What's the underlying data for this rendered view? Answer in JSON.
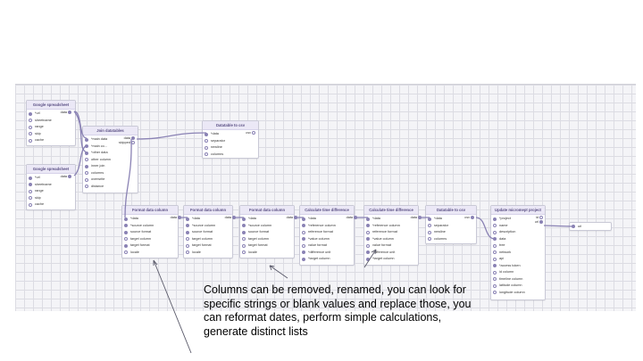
{
  "nodes": {
    "gs1": {
      "title": "Google spreadsheet",
      "output": "data",
      "rows": [
        {
          "label": "*url",
          "on": true
        },
        {
          "label": "sheetname",
          "on": false
        },
        {
          "label": "range",
          "on": false
        },
        {
          "label": "skip",
          "on": false
        },
        {
          "label": "cache",
          "on": false
        }
      ]
    },
    "gs2": {
      "title": "Google spreadsheet",
      "output": "data",
      "rows": [
        {
          "label": "*url",
          "on": true
        },
        {
          "label": "sheetname",
          "on": true
        },
        {
          "label": "range",
          "on": false
        },
        {
          "label": "skip",
          "on": false
        },
        {
          "label": "cache",
          "on": false
        }
      ]
    },
    "join": {
      "title": "Join datatables",
      "output": "data",
      "output2": "skipped",
      "rows": [
        {
          "label": "*main data",
          "on": true
        },
        {
          "label": "*main co...",
          "on": true
        },
        {
          "label": "*other data",
          "on": true
        },
        {
          "label": "other column",
          "on": false
        },
        {
          "label": "inner join",
          "on": true
        },
        {
          "label": "columns",
          "on": false
        },
        {
          "label": "overwrite",
          "on": false
        },
        {
          "label": "distance",
          "on": false
        }
      ]
    },
    "csv1": {
      "title": "Datatable to csv",
      "output": "csv",
      "rows": [
        {
          "label": "*data",
          "on": true
        },
        {
          "label": "separator",
          "on": false
        },
        {
          "label": "newline",
          "on": false
        },
        {
          "label": "columns",
          "on": false
        }
      ]
    },
    "fmt1": {
      "title": "Format data column",
      "output": "data",
      "rows": [
        {
          "label": "*data",
          "on": true
        },
        {
          "label": "*source column",
          "on": true
        },
        {
          "label": "source format",
          "on": true
        },
        {
          "label": "target column",
          "on": false
        },
        {
          "label": "target format",
          "on": true
        },
        {
          "label": "locale",
          "on": false
        }
      ]
    },
    "fmt2": {
      "title": "Format data column",
      "output": "data",
      "rows": [
        {
          "label": "*data",
          "on": true
        },
        {
          "label": "*source column",
          "on": true
        },
        {
          "label": "source format",
          "on": true
        },
        {
          "label": "target column",
          "on": false
        },
        {
          "label": "target format",
          "on": false
        },
        {
          "label": "locale",
          "on": false
        }
      ]
    },
    "fmt3": {
      "title": "Format data column",
      "output": "data",
      "rows": [
        {
          "label": "*data",
          "on": true
        },
        {
          "label": "*source column",
          "on": true
        },
        {
          "label": "source format",
          "on": true
        },
        {
          "label": "target column",
          "on": false
        },
        {
          "label": "target format",
          "on": false
        },
        {
          "label": "locale",
          "on": false
        }
      ]
    },
    "td1": {
      "title": "Calculate time difference",
      "output": "data",
      "rows": [
        {
          "label": "*data",
          "on": true
        },
        {
          "label": "*reference column",
          "on": true
        },
        {
          "label": "reference format",
          "on": false
        },
        {
          "label": "*value column",
          "on": true
        },
        {
          "label": "value format",
          "on": false
        },
        {
          "label": "*difference unit",
          "on": true
        },
        {
          "label": "*target column",
          "on": true
        }
      ]
    },
    "td2": {
      "title": "Calculate time difference",
      "output": "data",
      "rows": [
        {
          "label": "*data",
          "on": true
        },
        {
          "label": "*reference column",
          "on": true
        },
        {
          "label": "reference format",
          "on": false
        },
        {
          "label": "*value column",
          "on": true
        },
        {
          "label": "value format",
          "on": false
        },
        {
          "label": "*difference unit",
          "on": true
        },
        {
          "label": "*target column",
          "on": true
        }
      ]
    },
    "csv2": {
      "title": "Datatable to csv",
      "output": "csv",
      "rows": [
        {
          "label": "*data",
          "on": true
        },
        {
          "label": "separator",
          "on": false
        },
        {
          "label": "newline",
          "on": false
        },
        {
          "label": "columns",
          "on": false
        }
      ]
    },
    "upd": {
      "title": "Update micromept project",
      "output": "id",
      "output2": "url",
      "rows": [
        {
          "label": "*project",
          "on": true
        },
        {
          "label": "name",
          "on": false
        },
        {
          "label": "description",
          "on": false
        },
        {
          "label": "data",
          "on": true
        },
        {
          "label": "tree",
          "on": false
        },
        {
          "label": "network",
          "on": false
        },
        {
          "label": "api",
          "on": false
        },
        {
          "label": "*access token",
          "on": true
        },
        {
          "label": "id column",
          "on": false
        },
        {
          "label": "timeline column",
          "on": false
        },
        {
          "label": "latitude column",
          "on": false
        },
        {
          "label": "longitude column",
          "on": false
        }
      ]
    },
    "url": {
      "title": "",
      "output": "",
      "rows": [
        {
          "label": "url",
          "on": true
        }
      ]
    }
  },
  "caption": "Columns can be removed, renamed, you can look for specific strings or blank values and replace those, you can reformat dates, perform simple calculations, generate distinct lists",
  "colors": {
    "link": "#8a82b4",
    "port": "#8a82b4",
    "title_bg": "#ebe8f6"
  }
}
